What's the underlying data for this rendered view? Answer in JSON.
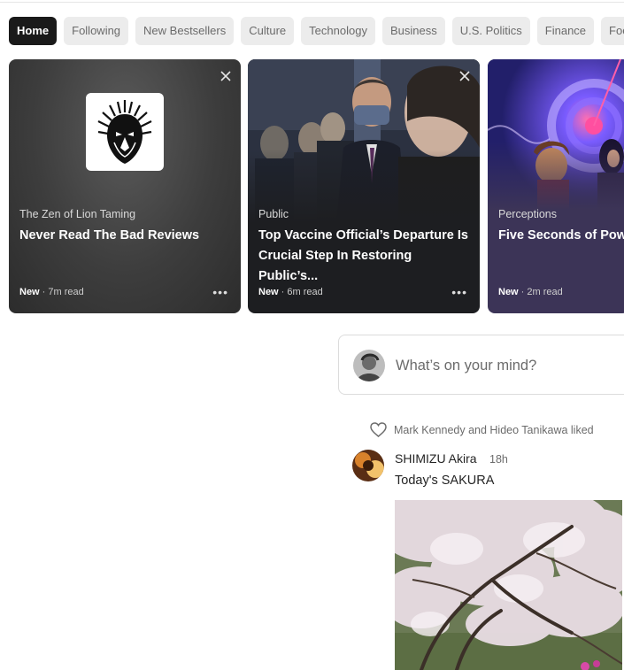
{
  "tabs": [
    {
      "label": "Home",
      "active": true
    },
    {
      "label": "Following"
    },
    {
      "label": "New Bestsellers"
    },
    {
      "label": "Culture"
    },
    {
      "label": "Technology"
    },
    {
      "label": "Business"
    },
    {
      "label": "U.S. Politics"
    },
    {
      "label": "Finance"
    },
    {
      "label": "Foo"
    }
  ],
  "cards": [
    {
      "publication": "The Zen of Lion Taming",
      "title": "Never Read The Bad Reviews",
      "badge": "New",
      "read_time": " · 7m read",
      "icon": "lion-logo"
    },
    {
      "publication": "Public",
      "title": "Top Vaccine Official’s Departure Is Crucial Step In Restoring Public’s...",
      "badge": "New",
      "read_time": " · 6m read"
    },
    {
      "publication": "Perceptions",
      "title": "Five Seconds of Powe",
      "badge": "New",
      "read_time": " · 2m read"
    }
  ],
  "composer": {
    "placeholder": "What’s on your mind?"
  },
  "feed": {
    "liked_by": "Mark Kennedy and Hideo Tanikawa liked",
    "author": "SHIMIZU Akira",
    "time": "18h",
    "text": "Today's SAKURA"
  },
  "colors": {
    "active_tab": "#1a1a1a",
    "tab_bg": "#ececec",
    "card3_bg": "#3c3457"
  }
}
